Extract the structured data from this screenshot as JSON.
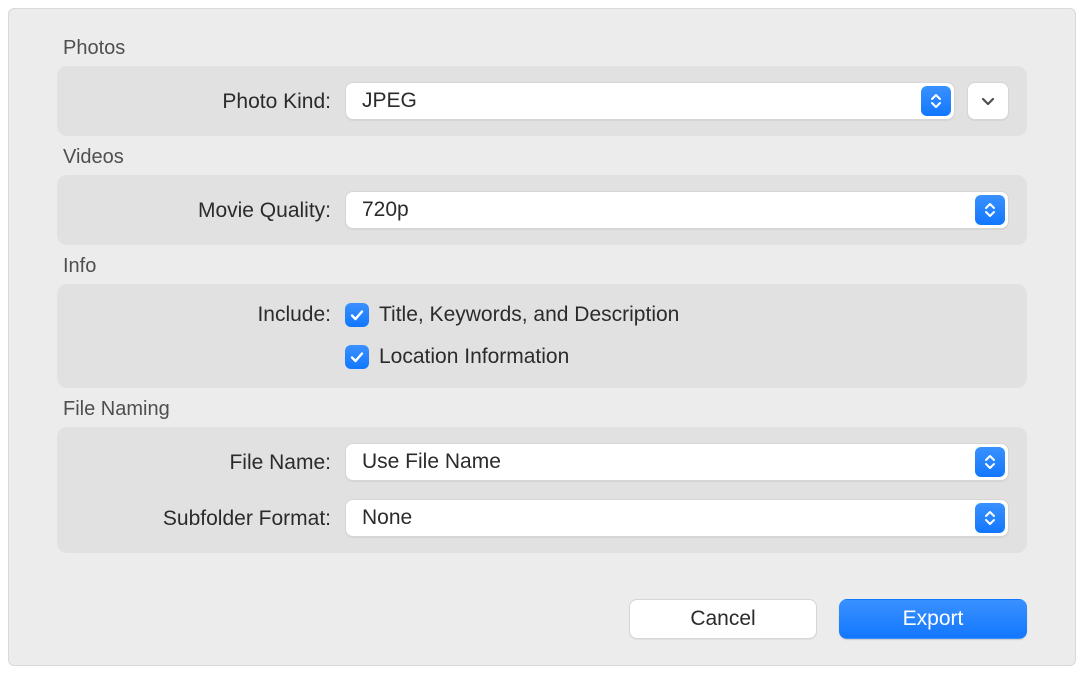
{
  "photos": {
    "section_title": "Photos",
    "kind_label": "Photo Kind:",
    "kind_value": "JPEG"
  },
  "videos": {
    "section_title": "Videos",
    "quality_label": "Movie Quality:",
    "quality_value": "720p"
  },
  "info": {
    "section_title": "Info",
    "include_label": "Include:",
    "checks": {
      "tkd_label": "Title, Keywords, and Description",
      "tkd_checked": true,
      "loc_label": "Location Information",
      "loc_checked": true
    }
  },
  "file_naming": {
    "section_title": "File Naming",
    "filename_label": "File Name:",
    "filename_value": "Use File Name",
    "subfolder_label": "Subfolder Format:",
    "subfolder_value": "None"
  },
  "buttons": {
    "cancel": "Cancel",
    "export": "Export"
  },
  "colors": {
    "accent": "#1c7aff"
  }
}
